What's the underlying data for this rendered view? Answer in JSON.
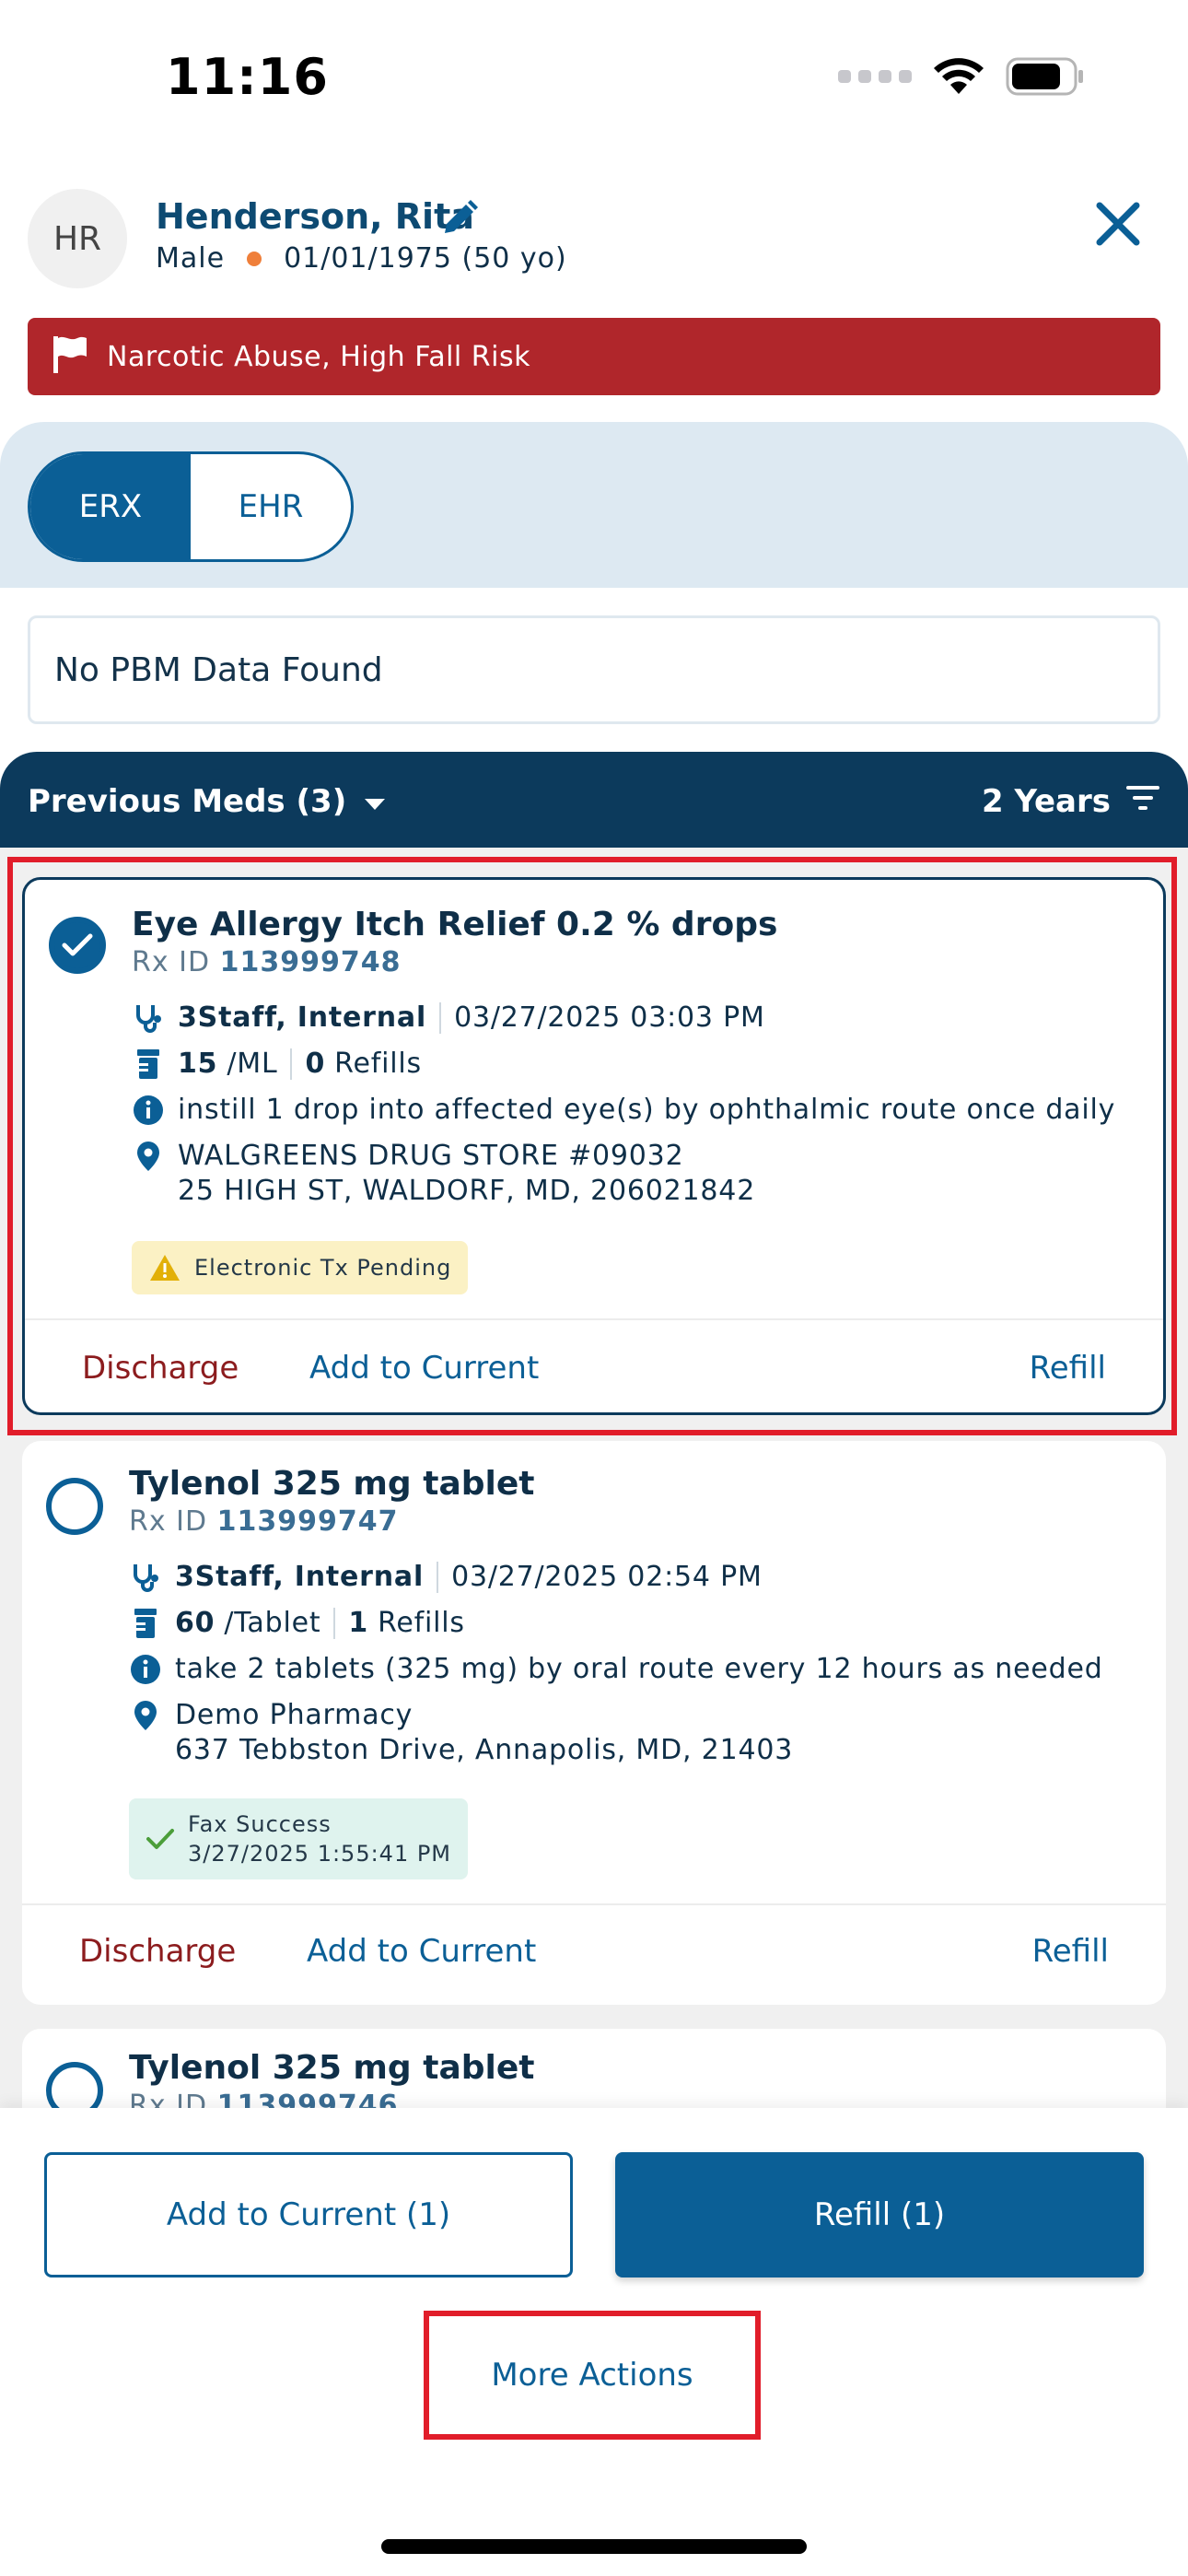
{
  "status_bar": {
    "time": "11:16"
  },
  "patient": {
    "initials": "HR",
    "name": "Henderson, Rita",
    "gender": "Male",
    "dob": "01/01/1975 (50 yo)"
  },
  "alert": {
    "text": "Narcotic Abuse, High Fall Risk",
    "color": "#b0262b"
  },
  "tabs": [
    {
      "label": "ERX",
      "active": true
    },
    {
      "label": "EHR",
      "active": false
    }
  ],
  "pbm": {
    "message": "No PBM Data Found"
  },
  "list_header": {
    "title": "Previous Meds (3)",
    "filter": "2 Years"
  },
  "meds": [
    {
      "name": "Eye Allergy Itch Relief 0.2 % drops",
      "rx_label": "Rx ID",
      "rx_id": "113999748",
      "prescriber": "3Staff, Internal",
      "datetime": "03/27/2025 03:03 PM",
      "qty": "15",
      "unit": "/ML",
      "refills_count": "0",
      "refills_label": "Refills",
      "sig": "instill 1 drop into affected eye(s) by ophthalmic route once daily",
      "pharmacy_name": "WALGREENS DRUG STORE #09032",
      "pharmacy_address": "25 HIGH ST, WALDORF, MD, 206021842",
      "status_line1": "Electronic Tx Pending",
      "status_type": "warning",
      "selected": true,
      "actions": {
        "discharge": "Discharge",
        "add_current": "Add to Current",
        "refill": "Refill"
      }
    },
    {
      "name": "Tylenol 325 mg tablet",
      "rx_label": "Rx ID",
      "rx_id": "113999747",
      "prescriber": "3Staff, Internal",
      "datetime": "03/27/2025 02:54 PM",
      "qty": "60",
      "unit": "/Tablet",
      "refills_count": "1",
      "refills_label": "Refills",
      "sig": "take 2 tablets (325 mg) by oral route every 12 hours as needed",
      "pharmacy_name": "Demo Pharmacy",
      "pharmacy_address": "637 Tebbston Drive, Annapolis, MD, 21403",
      "status_line1": "Fax Success",
      "status_line2": "3/27/2025 1:55:41 PM",
      "status_type": "success",
      "selected": false,
      "actions": {
        "discharge": "Discharge",
        "add_current": "Add to Current",
        "refill": "Refill"
      }
    },
    {
      "name": "Tylenol 325 mg tablet",
      "rx_label": "Rx ID",
      "rx_id": "113999746",
      "selected": false
    }
  ],
  "bottom_bar": {
    "add_current_label": "Add to Current (1)",
    "refill_label": "Refill (1)",
    "more_actions_label": "More Actions"
  },
  "colors": {
    "primary": "#0b5f96",
    "header_navy": "#0c3a5c",
    "discharge_red": "#8c1c1e",
    "highlight_red": "#e11d2a"
  }
}
